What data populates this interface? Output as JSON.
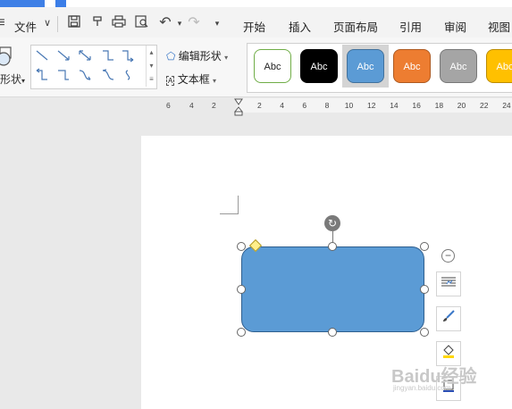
{
  "menu": {
    "file_label": "文件",
    "tabs": [
      "开始",
      "插入",
      "页面布局",
      "引用",
      "审阅",
      "视图"
    ]
  },
  "ribbon": {
    "shape_label": "形状",
    "edit_shape_label": "编辑形状",
    "text_box_label": "文本框",
    "style_samples": [
      {
        "label": "Abc",
        "fill": "#ffffff",
        "border": "#70ad47",
        "text": "#222222"
      },
      {
        "label": "Abc",
        "fill": "#000000",
        "border": "#000000",
        "text": "#ffffff"
      },
      {
        "label": "Abc",
        "fill": "#5b9bd5",
        "border": "#41719c",
        "text": "#ffffff",
        "selected": true
      },
      {
        "label": "Abc",
        "fill": "#ed7d31",
        "border": "#ae5a21",
        "text": "#ffffff"
      },
      {
        "label": "Abc",
        "fill": "#a5a5a5",
        "border": "#787878",
        "text": "#ffffff"
      },
      {
        "label": "Abc",
        "fill": "#ffc000",
        "border": "#bc8c00",
        "text": "#ffffff"
      }
    ]
  },
  "ruler": {
    "left_ticks": [
      "6",
      "4",
      "2"
    ],
    "right_ticks": [
      "2",
      "4",
      "6",
      "8",
      "10",
      "12",
      "14",
      "16",
      "18",
      "20",
      "22",
      "24"
    ]
  },
  "canvas": {
    "shape_fill": "#5b9bd5",
    "shape_type": "rounded-rectangle"
  },
  "watermark": {
    "text": "Baidu经验",
    "sub": "jingyan.baidu.com"
  }
}
